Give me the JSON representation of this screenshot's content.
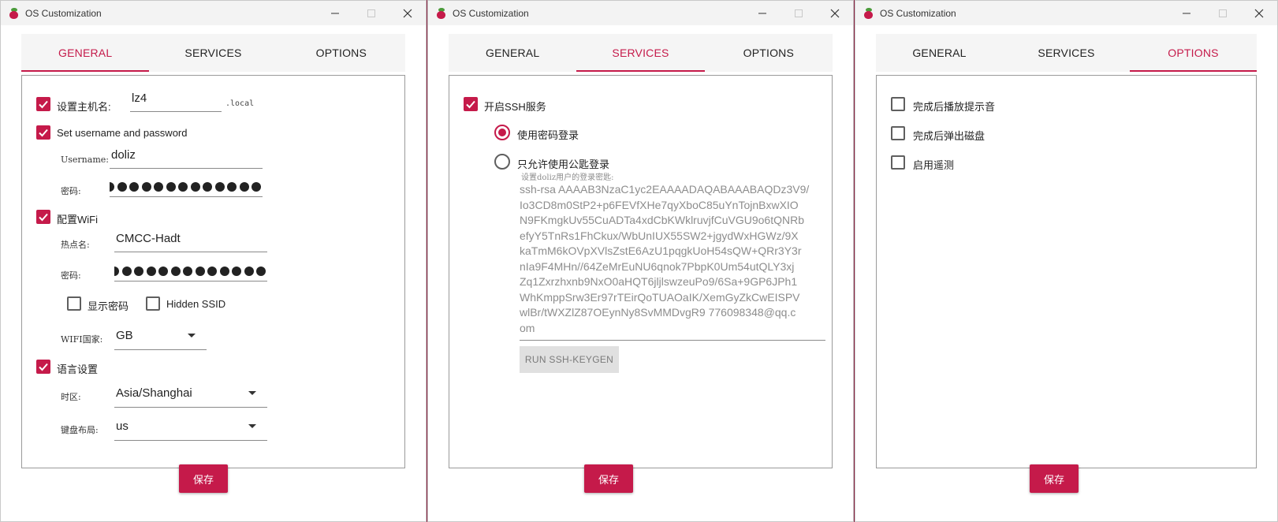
{
  "window_title": "OS Customization",
  "tabs": {
    "general": "GENERAL",
    "services": "SERVICES",
    "options": "OPTIONS"
  },
  "save_label": "保存",
  "general": {
    "hostname_label": "设置主机名:",
    "hostname_value": "lz4",
    "hostname_suffix": ".local",
    "userpass_label": "Set username and password",
    "username_label": "Username:",
    "username_value": "doliz",
    "password_label": "密码:",
    "wifi_label": "配置WiFi",
    "ssid_label": "热点名:",
    "ssid_value": "CMCC-Hadt",
    "wifi_password_label": "密码:",
    "show_password_label": "显示密码",
    "hidden_ssid_label": "Hidden SSID",
    "wifi_country_label": "WIFI国家:",
    "wifi_country_value": "GB",
    "locale_label": "语言设置",
    "timezone_label": "时区:",
    "timezone_value": "Asia/Shanghai",
    "keyboard_label": "键盘布局:",
    "keyboard_value": "us"
  },
  "services": {
    "ssh_enable_label": "开启SSH服务",
    "password_auth_label": "使用密码登录",
    "pubkey_auth_label": "只允许使用公匙登录",
    "pubkey_hint": "设置doliz用户的登录密匙:",
    "pubkey_lines": [
      "ssh-rsa AAAAB3NzaC1yc2EAAAADAQABAAABAQDz3V9/",
      "Io3CD8m0StP2+p6FEVfXHe7qyXboC85uYnTojnBxwXIO",
      "N9FKmgkUv55CuADTa4xdCbKWklruvjfCuVGU9o6tQNRb",
      "efyY5TnRs1FhCkux/WbUnIUX55SW2+jgydWxHGWz/9X",
      "kaTmM6kOVpXVlsZstE6AzU1pqgkUoH54sQW+QRr3Y3r",
      "nIa9F4MHn//64ZeMrEuNU6qnok7PbpK0Um54utQLY3xj",
      "Zq1Zxrzhxnb9NxO0aHQT6jljlswzeuPo9/6Sa+9GP6JPh1",
      "WhKmppSrw3Er97rTEirQoTUAOaIK/XemGyZkCwEISPV",
      "wlBr/tWXZlZ87OEynNy8SvMMDvgR9 776098348@qq.c",
      "om"
    ],
    "keygen_label": "RUN SSH-KEYGEN"
  },
  "options": {
    "beep_label": "完成后播放提示音",
    "eject_label": "完成后弹出磁盘",
    "telemetry_label": "启用遥测"
  }
}
